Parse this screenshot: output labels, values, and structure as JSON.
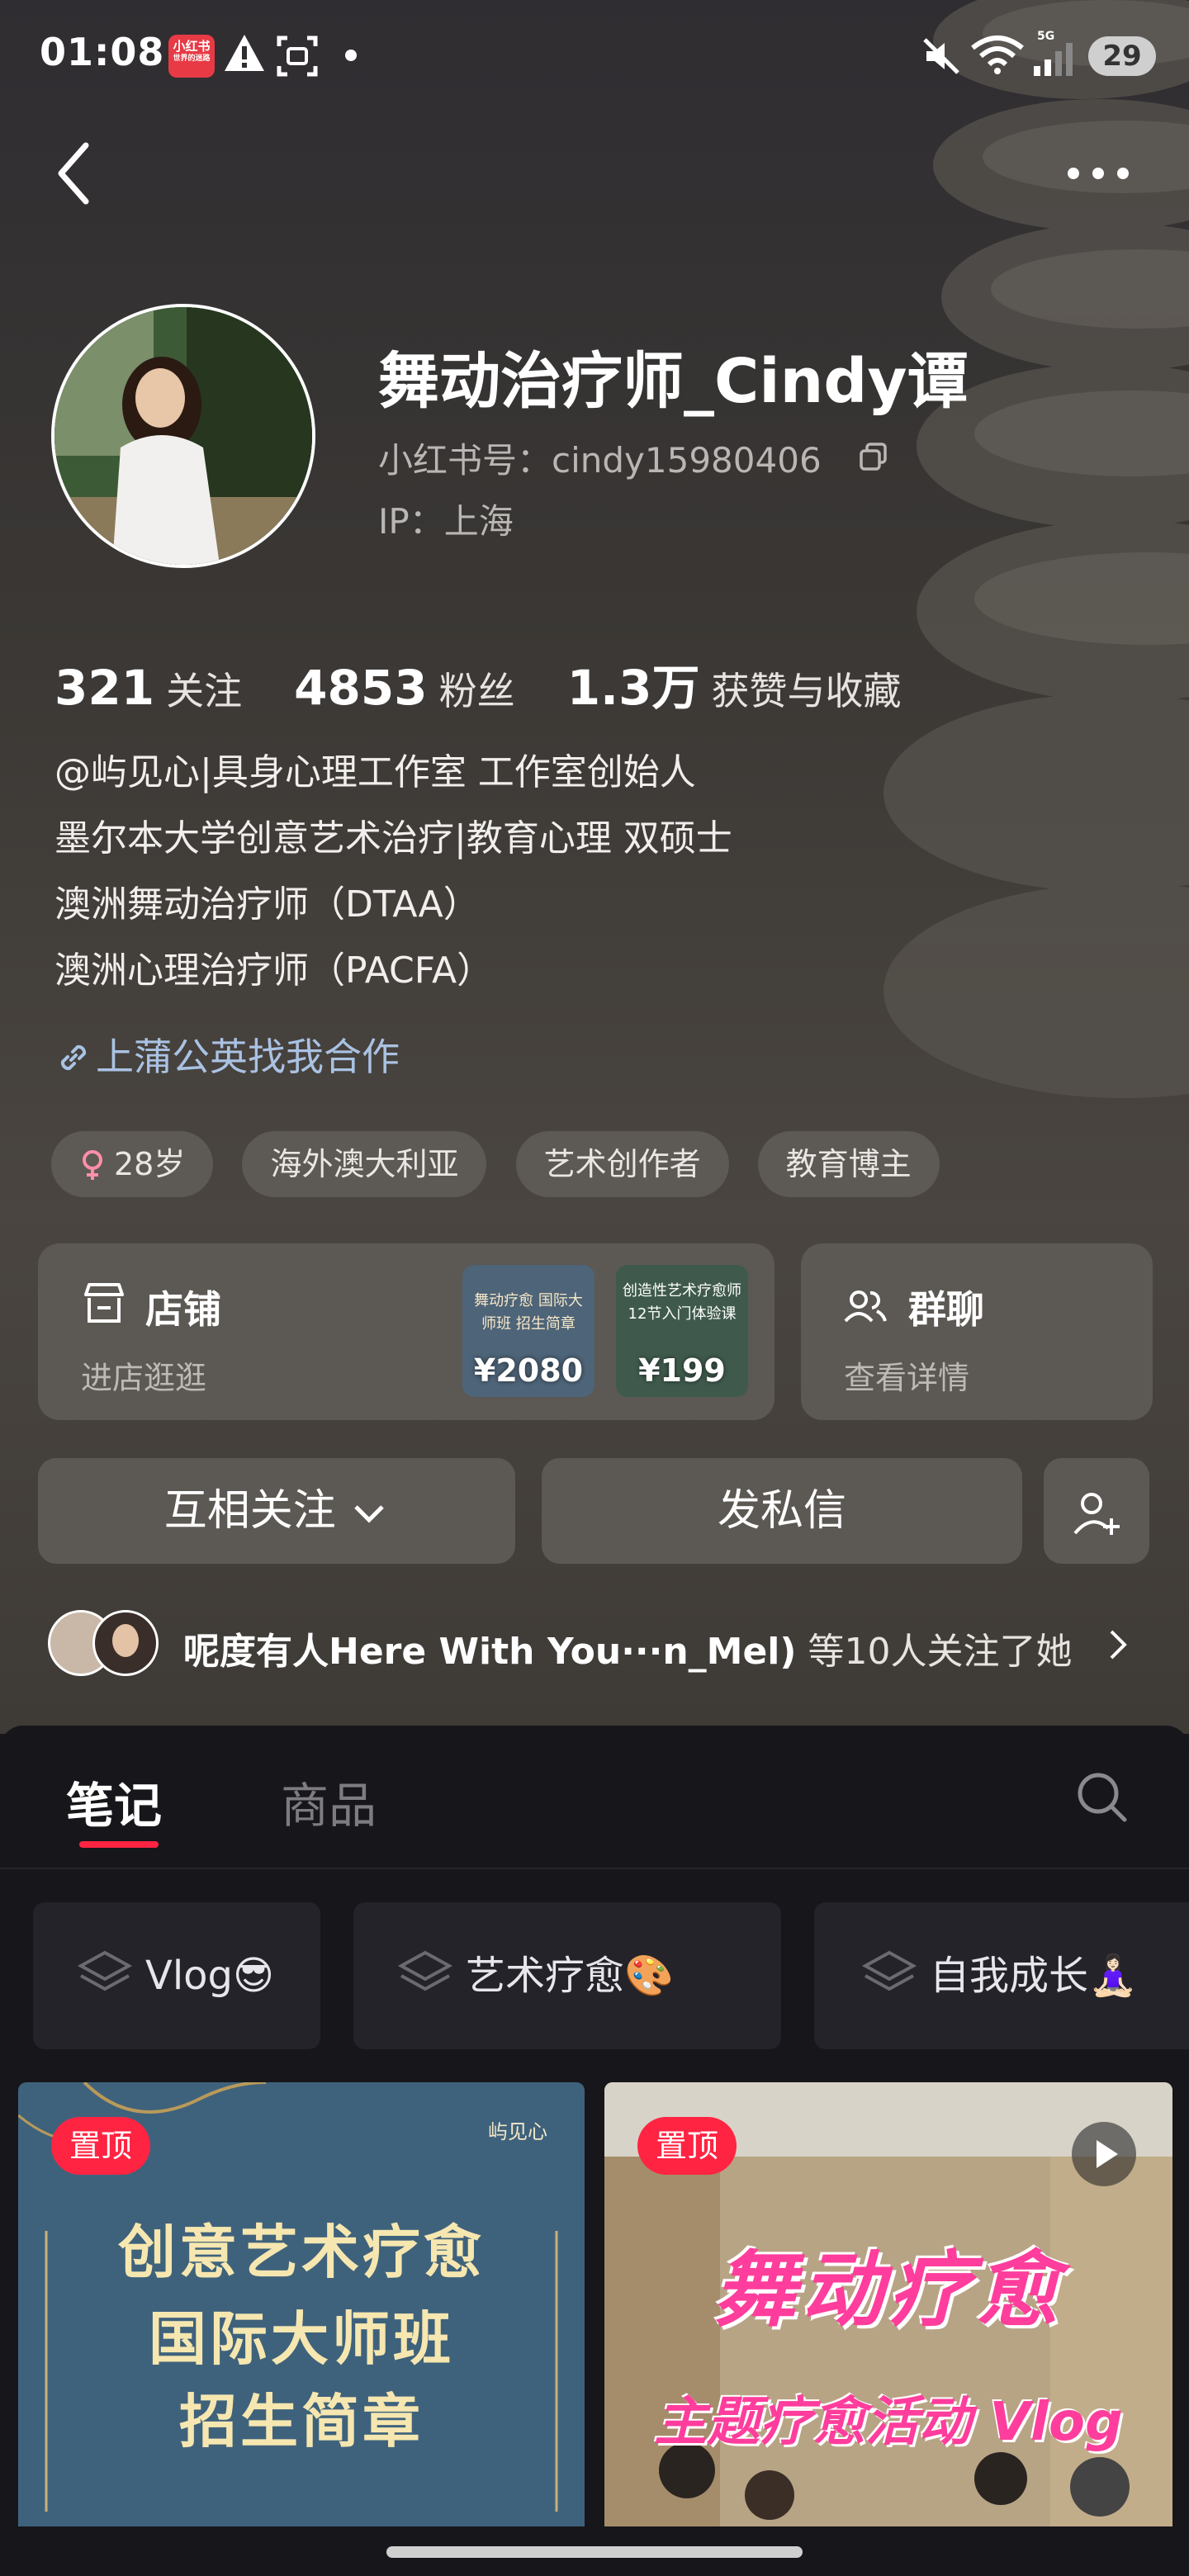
{
  "status_bar": {
    "time": "01:08",
    "app_icon_label": "小红书",
    "app_icon_sub": "世界的迷路",
    "network": "5G",
    "battery": "29"
  },
  "profile": {
    "name": "舞动治疗师_Cindy谭",
    "red_id": "小红书号：cindy15980406",
    "ip": "IP：上海",
    "stats": [
      {
        "value": "321",
        "label": "关注"
      },
      {
        "value": "4853",
        "label": "粉丝"
      },
      {
        "value": "1.3万",
        "label": "获赞与收藏"
      }
    ],
    "bio": [
      "@屿见心|具身心理工作室 工作室创始人",
      "墨尔本大学创意艺术治疗|教育心理 双硕士",
      "澳洲舞动治疗师（DTAA）",
      "澳洲心理治疗师（PACFA）"
    ],
    "link": "上蒲公英找我合作",
    "tags": [
      "28岁",
      "海外澳大利亚",
      "艺术创作者",
      "教育博主"
    ]
  },
  "shop": {
    "title": "店铺",
    "subtitle": "进店逛逛",
    "items": [
      {
        "text": "舞动疗愈 国际大师班 招生简章",
        "price": "¥2080"
      },
      {
        "text": "创造性艺术疗愈师 12节入门体验课",
        "price": "¥199"
      }
    ]
  },
  "group_chat": {
    "title": "群聊",
    "subtitle": "查看详情"
  },
  "actions": {
    "follow": "互相关注",
    "message": "发私信"
  },
  "mutual": {
    "names": "呢度有人Here With You···n_Mel)",
    "rest": "等10人关注了她"
  },
  "tabs": {
    "notes": "笔记",
    "goods": "商品"
  },
  "categories": [
    {
      "label": "Vlog",
      "emoji": "😎"
    },
    {
      "label": "艺术疗愈",
      "emoji": "🎨"
    },
    {
      "label": "自我成长",
      "emoji": "🧘🏻‍♀️"
    }
  ],
  "posts": [
    {
      "badge": "置顶",
      "lines": [
        "创意艺术疗愈",
        "国际大师班",
        "招生简章"
      ],
      "brand": "屿见心"
    },
    {
      "badge": "置顶",
      "title": "舞动疗愈",
      "subtitle": "主题疗愈活动 Vlog"
    }
  ],
  "colors": {
    "accent": "#ff2442",
    "link": "#aac2e3"
  }
}
